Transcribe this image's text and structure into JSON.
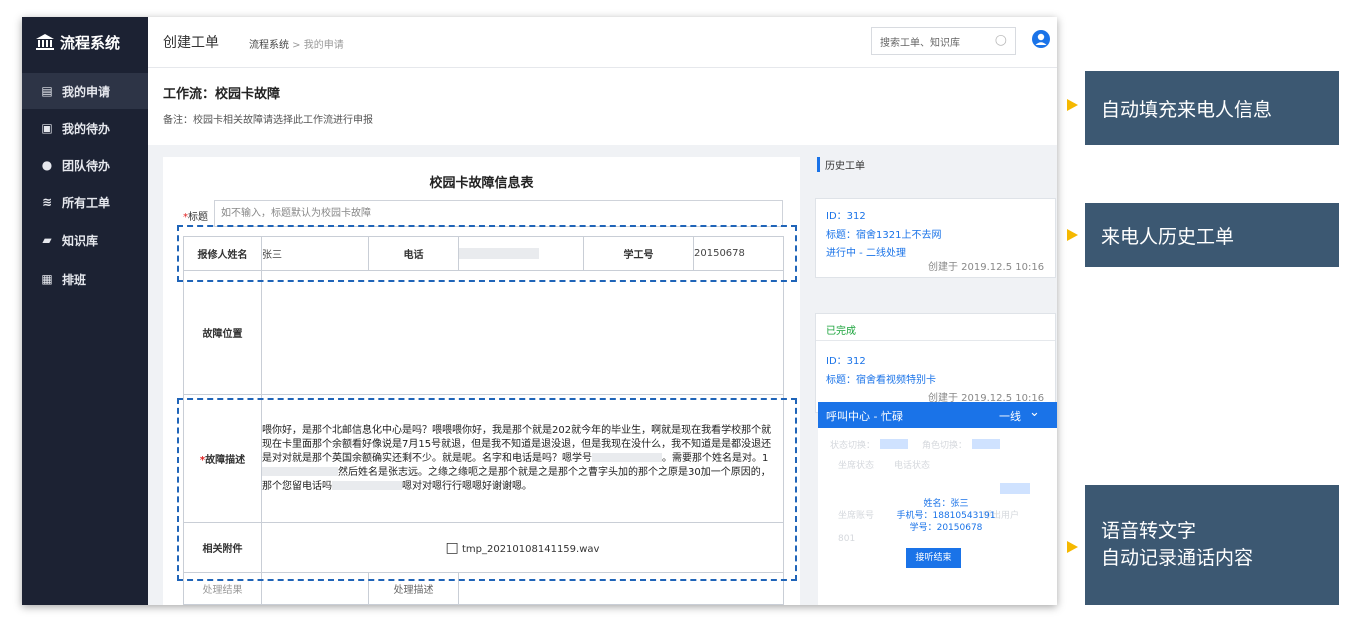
{
  "sidebar": {
    "logo": "流程系统",
    "items": [
      {
        "label": "我的申请",
        "icon": "clipboard-icon"
      },
      {
        "label": "我的待办",
        "icon": "todo-icon"
      },
      {
        "label": "团队待办",
        "icon": "team-icon"
      },
      {
        "label": "所有工单",
        "icon": "layers-icon"
      },
      {
        "label": "知识库",
        "icon": "book-icon"
      },
      {
        "label": "排班",
        "icon": "calendar-icon"
      }
    ]
  },
  "topbar": {
    "title": "创建工单",
    "breadcrumb_root": "流程系统",
    "breadcrumb_sep": " > ",
    "breadcrumb_current": "我的申请",
    "search_placeholder": "搜索工单、知识库"
  },
  "workflow": {
    "title": "工作流：校园卡故障",
    "note": "备注：校园卡相关故障请选择此工作流进行申报"
  },
  "form": {
    "title": "校园卡故障信息表",
    "title_label": "标题",
    "title_placeholder": "如不输入，标题默认为校园卡故障",
    "reporter_label": "报修人姓名",
    "reporter_value": "张三",
    "phone_label": "电话",
    "student_id_label": "学工号",
    "student_id_value": "20150678",
    "location_label": "故障位置",
    "desc_label": "故障描述",
    "desc_line1": "喂你好，是那个北邮信息化中心是吗？喂喂喂你好，我是那个就是202就今年的毕业生，啊就是现在我看学校那个就",
    "desc_line2": "现在卡里面那个余额看好像说是7月15号就退，但是我不知道是退没退，但是我现在没什么，我不知道是是都没退还",
    "desc_line3": "是对对就是那个英国余额确实还剩不少。就是呢。名字和电话是吗？嗯学号",
    "desc_line3b": "。需要那个姓名是对。1",
    "desc_line4": "然后姓名是张志远。之缘之缘呃之是那个就是之是那个之曹字头加的那个之原是30加一个原因的，",
    "desc_line5a": "那个您留电话吗",
    "desc_line5b": "嗯对对嗯行行嗯嗯好谢谢嗯。",
    "attach_label": "相关附件",
    "attach_file": "tmp_20210108141159.wav",
    "result_label": "处理结果",
    "handle_desc_label": "处理描述"
  },
  "history": {
    "header": "历史工单",
    "ticket1": {
      "id": "ID：312",
      "title": "标题：宿舍1321上不去网",
      "status": "进行中 - 二线处理",
      "created": "创建于 2019.12.5  10:16"
    },
    "ticket2": {
      "status": "已完成",
      "id": "ID：312",
      "title": "标题：宿舍看视频特别卡",
      "created": "创建于 2019.12.5  10:16"
    }
  },
  "callcenter": {
    "title": "呼叫中心 - 忙碌",
    "line": "一线",
    "ghost1": "状态切换：",
    "ghost2": "角色切换：",
    "ghost3": "坐席状态",
    "ghost4": "电话状态",
    "ghost5": "坐席账号",
    "ghost6": "801",
    "ghost7": "呼出用户",
    "info_name": "姓名：张三",
    "info_phone": "手机号：18810543191",
    "info_id": "学号：20150678",
    "hangup": "接听结束"
  },
  "callouts": {
    "autofill": "自动填充来电人信息",
    "history": "来电人历史工单",
    "speech_line1": "语音转文字",
    "speech_line2": "自动记录通话内容"
  },
  "colors": {
    "sidebar_bg": "#1c2233",
    "accent": "#1a73e8",
    "callout_bg": "#3c5872",
    "dash": "#1f64b8",
    "arrow": "#f5b800"
  }
}
